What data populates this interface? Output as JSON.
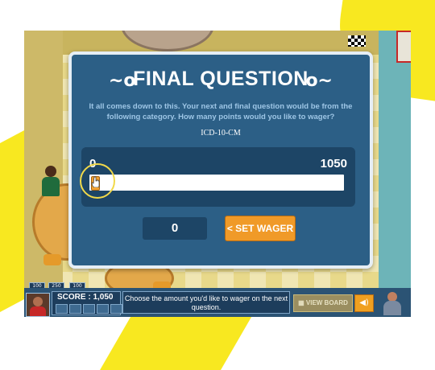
{
  "dialog": {
    "title": "FINAL QUESTION",
    "message": "It all comes down to this. Your next and final question would be from the following category. How many points would you like to wager?",
    "category": "ICD-10-CM",
    "slider": {
      "min_label": "0",
      "max_label": "1050",
      "current_fraction": 0.0
    },
    "wager_value": "0",
    "set_wager_label": "< SET WAGER"
  },
  "bottom_bar": {
    "score_label": "SCORE : 1,050",
    "message": "Choose the amount you'd like to wager on the next question.",
    "view_board_label": "VIEW BOARD",
    "mini_buttons": [
      "100",
      "250",
      "100"
    ]
  },
  "colors": {
    "dialog_bg": "#2c5f86",
    "accent": "#f09a28",
    "bar_bg": "#2b5374",
    "highlight": "#f1d94a"
  },
  "icons": {
    "checkered_flag": "checkered-flag-icon",
    "hand_cursor": "hand-cursor-icon",
    "sound": "speaker-icon",
    "view_board": "board-icon"
  }
}
